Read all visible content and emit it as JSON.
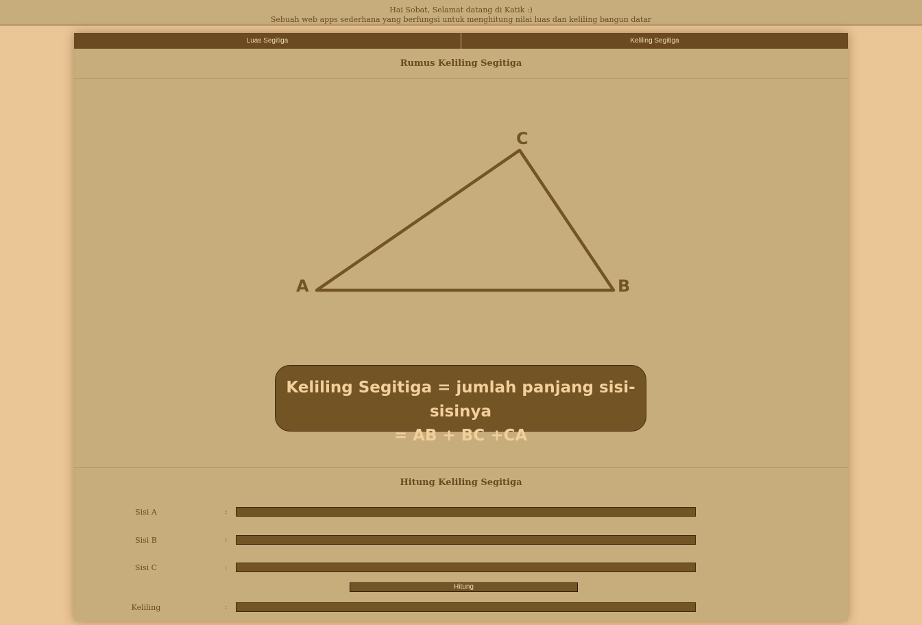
{
  "header": {
    "greeting": "Hai Sobat, Selamat datang di Katik :)",
    "subtitle": "Sebuah web apps sederhana yang berfungsi untuk menghitung nilai luas dan keliling bangun datar"
  },
  "tabs": [
    {
      "label": "Luas Segitiga"
    },
    {
      "label": "Keliling Segitiga"
    }
  ],
  "rumus": {
    "title": "Rumus Keliling Segitiga",
    "vertex_a": "A",
    "vertex_b": "B",
    "vertex_c": "C",
    "formula_line1": "Keliling Segitiga = jumlah panjang sisi-sisinya",
    "formula_line2": "= AB + BC +CA"
  },
  "hitung": {
    "title": "Hitung Keliling Segitiga",
    "sisi_a_label": "Sisi A",
    "sisi_b_label": "Sisi B",
    "sisi_c_label": "Sisi C",
    "keliling_label": "Keliling",
    "colon": ":",
    "sisi_a_value": "",
    "sisi_b_value": "",
    "sisi_c_value": "",
    "keliling_value": "",
    "button_label": "Hitung"
  },
  "colors": {
    "background": "#eac595",
    "panel": "#c7ad7b",
    "accent": "#6b4a22",
    "formula_bg": "#735424",
    "formula_text": "#f2cf9c"
  }
}
